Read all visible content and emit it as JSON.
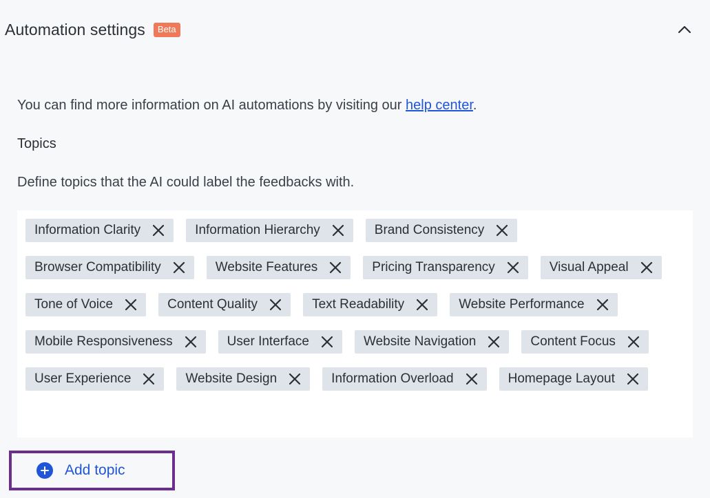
{
  "header": {
    "title": "Automation settings",
    "badge": "Beta"
  },
  "info": {
    "text_before": "You can find more information on AI automations by visiting our ",
    "link_text": "help center",
    "text_after": "."
  },
  "topics_section": {
    "title": "Topics",
    "description": "Define topics that the AI could label the feedbacks with.",
    "items": [
      "Information Clarity",
      "Information Hierarchy",
      "Brand Consistency",
      "Browser Compatibility",
      "Website Features",
      "Pricing Transparency",
      "Visual Appeal",
      "Tone of Voice",
      "Content Quality",
      "Text Readability",
      "Website Performance",
      "Mobile Responsiveness",
      "User Interface",
      "Website Navigation",
      "Content Focus",
      "User Experience",
      "Website Design",
      "Information Overload",
      "Homepage Layout"
    ],
    "add_label": "Add topic"
  },
  "colors": {
    "accent": "#1f55d6",
    "badge": "#ef7a5a",
    "chip_bg": "#dfe3ea",
    "highlight_border": "#6b2e8e"
  },
  "icons": {
    "collapse": "chevron-up-icon",
    "remove": "close-icon",
    "add": "plus-circle-icon"
  }
}
